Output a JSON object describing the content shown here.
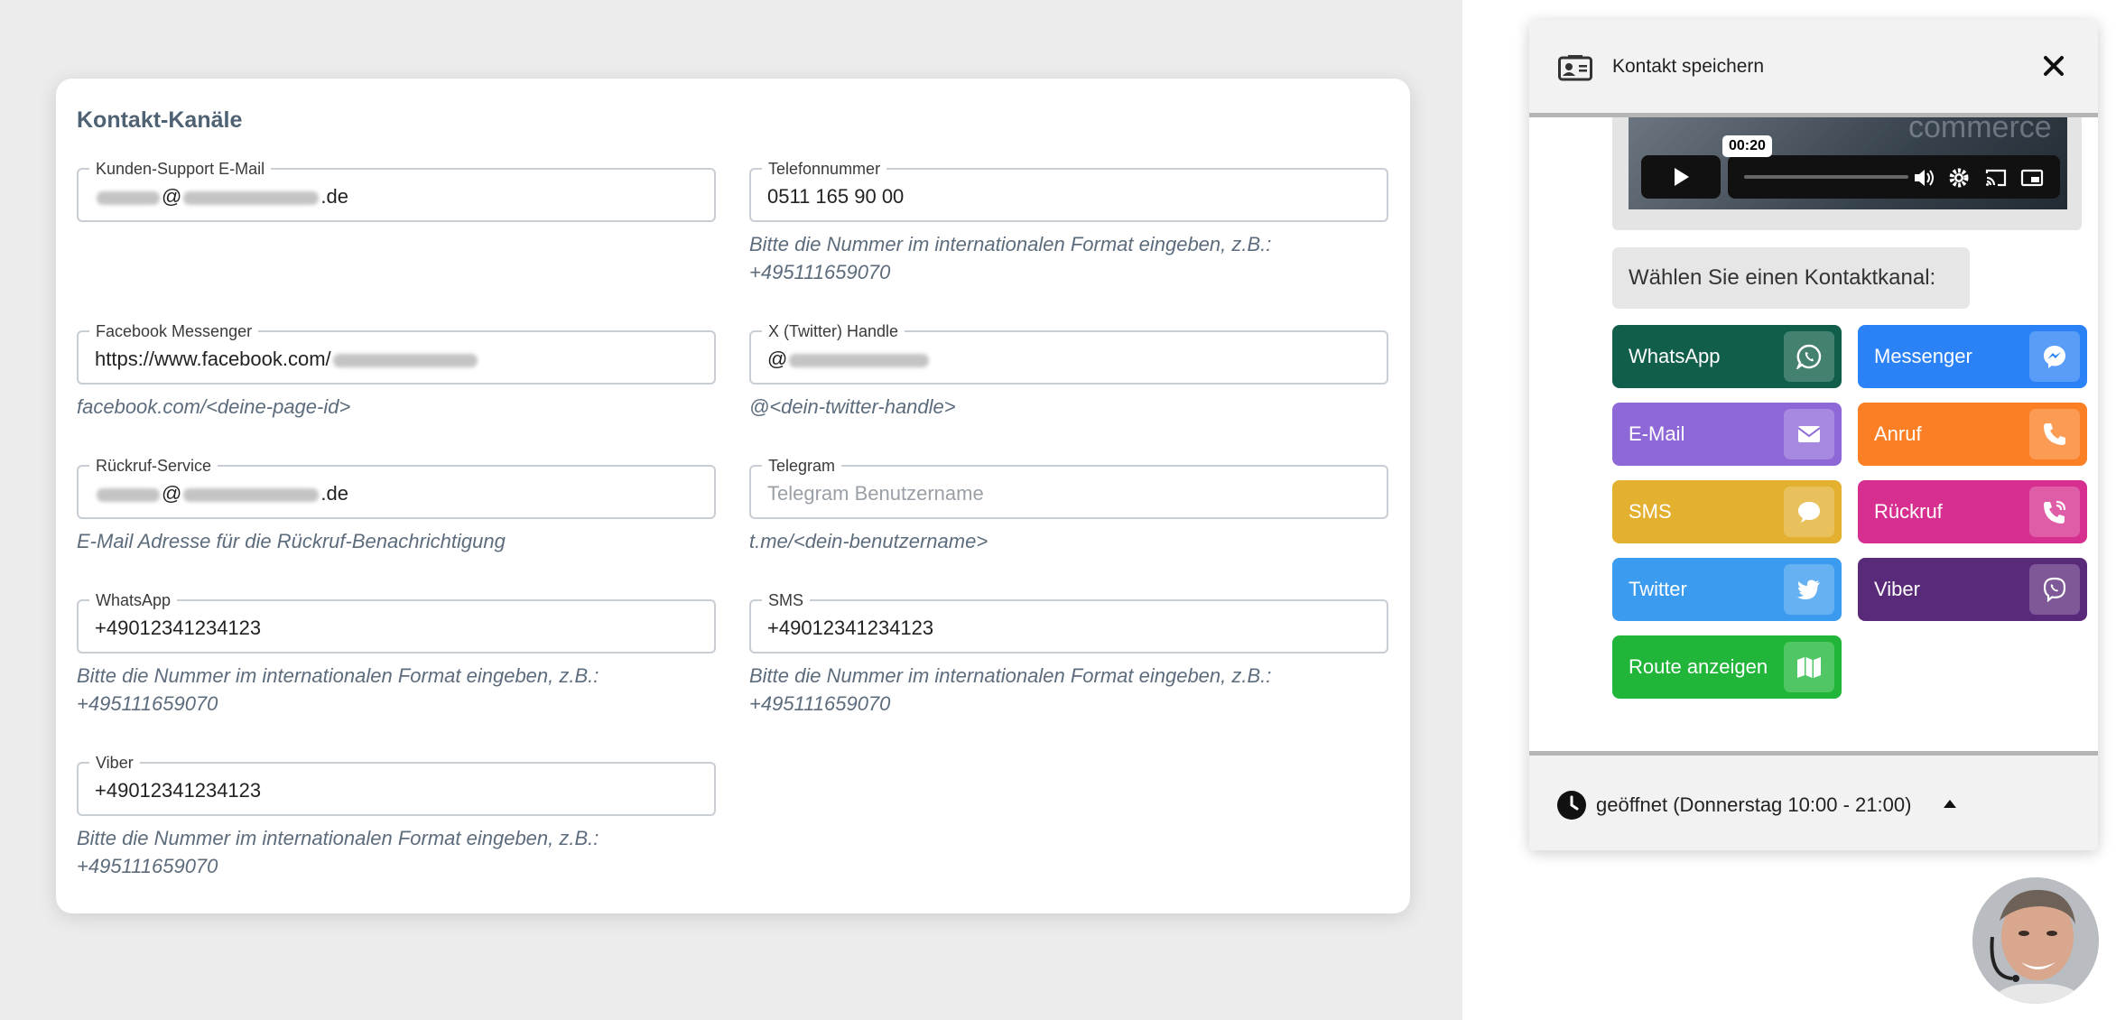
{
  "form": {
    "title": "Kontakt-Kanäle",
    "fields": {
      "support_email": {
        "label": "Kunden-Support E-Mail",
        "value_prefix": "",
        "value_at": "@",
        "value_suffix": ".de"
      },
      "phone": {
        "label": "Telefonnummer",
        "value": "0511 165 90 00",
        "hint": "Bitte die Nummer im internationalen Format eingeben, z.B.: +495111659070"
      },
      "messenger": {
        "label": "Facebook Messenger",
        "value": "https://www.facebook.com/",
        "hint": "facebook.com/<deine-page-id>"
      },
      "twitter": {
        "label": "X (Twitter) Handle",
        "value": "@",
        "hint": "@<dein-twitter-handle>"
      },
      "callback": {
        "label": "Rückruf-Service",
        "value_at": "@",
        "value_suffix": ".de",
        "hint": "E-Mail Adresse für die Rückruf-Benachrichtigung"
      },
      "telegram": {
        "label": "Telegram",
        "placeholder": "Telegram Benutzername",
        "hint": "t.me/<dein-benutzername>"
      },
      "whatsapp": {
        "label": "WhatsApp",
        "value": "+49012341234123",
        "hint": "Bitte die Nummer im internationalen Format eingeben, z.B.: +495111659070"
      },
      "sms": {
        "label": "SMS",
        "value": "+49012341234123",
        "hint": "Bitte die Nummer im internationalen Format eingeben, z.B.: +495111659070"
      },
      "viber": {
        "label": "Viber",
        "value": "+49012341234123",
        "hint": "Bitte die Nummer im internationalen Format eingeben, z.B.: +495111659070"
      }
    }
  },
  "widget": {
    "title": "Kontakt speichern",
    "video": {
      "time": "00:20",
      "overlay_text": "commerce"
    },
    "prompt": "Wählen Sie einen Kontaktkanal:",
    "channels": [
      {
        "label": "WhatsApp",
        "color": "#115e4a",
        "icon": "whatsapp-icon"
      },
      {
        "label": "Messenger",
        "color": "#2b82f6",
        "icon": "messenger-icon"
      },
      {
        "label": "E-Mail",
        "color": "#8f68d8",
        "icon": "envelope-icon"
      },
      {
        "label": "Anruf",
        "color": "#fa7f25",
        "icon": "phone-icon"
      },
      {
        "label": "SMS",
        "color": "#e3b02f",
        "icon": "chat-bubble-icon"
      },
      {
        "label": "Rückruf",
        "color": "#d62f8f",
        "icon": "phone-callback-icon"
      },
      {
        "label": "Twitter",
        "color": "#3b9bef",
        "icon": "twitter-bird-icon"
      },
      {
        "label": "Viber",
        "color": "#5a2a7a",
        "icon": "viber-icon"
      },
      {
        "label": "Route anzeigen",
        "color": "#21b63a",
        "icon": "map-icon"
      }
    ],
    "hours": "geöffnet (Donnerstag 10:00 - 21:00)"
  }
}
